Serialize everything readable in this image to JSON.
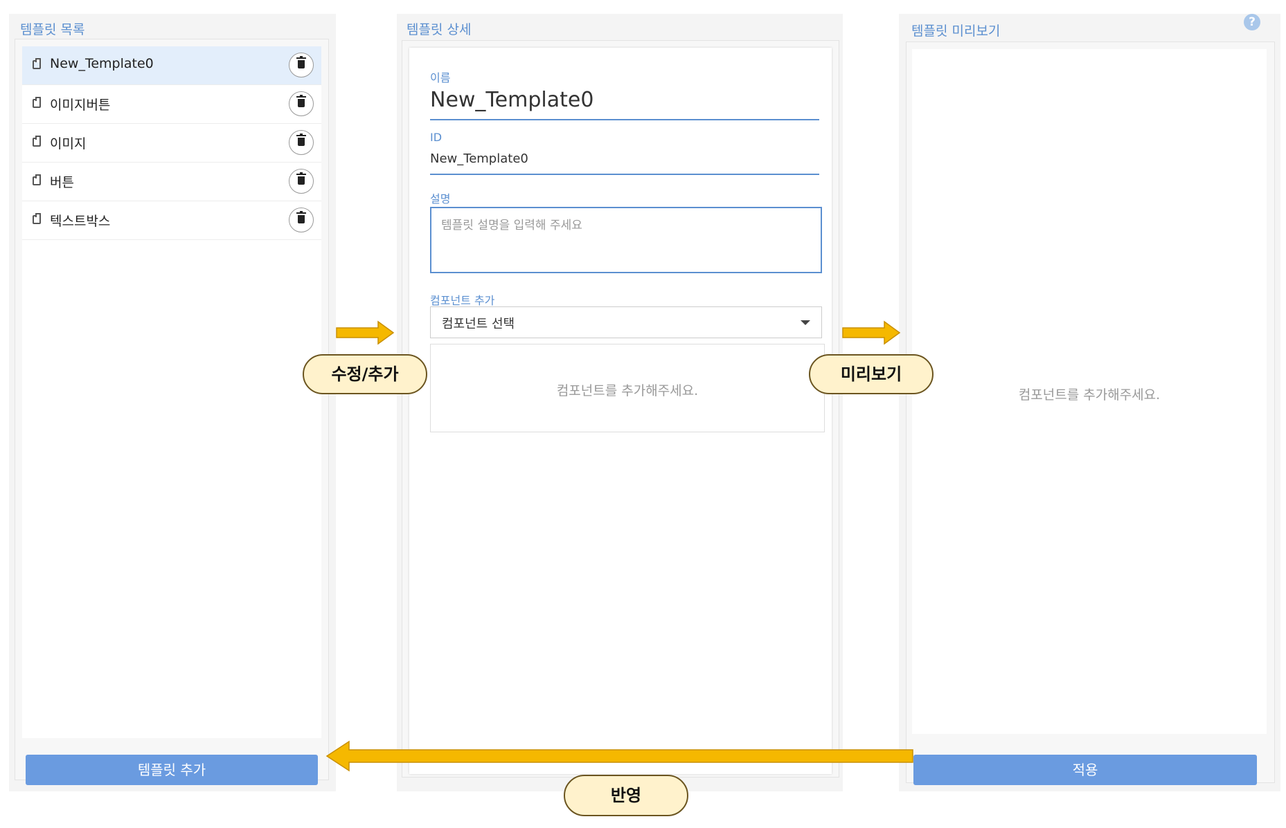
{
  "left_panel": {
    "title": "템플릿 목록",
    "items": [
      {
        "label": "New_Template0",
        "selected": true
      },
      {
        "label": "이미지버튼",
        "selected": false
      },
      {
        "label": "이미지",
        "selected": false
      },
      {
        "label": "버튼",
        "selected": false
      },
      {
        "label": "텍스트박스",
        "selected": false
      }
    ],
    "add_button": "템플릿 추가"
  },
  "middle_panel": {
    "title": "템플릿 상세",
    "name_label": "이름",
    "name_value": "New_Template0",
    "id_label": "ID",
    "id_value": "New_Template0",
    "desc_label": "설명",
    "desc_placeholder": "템플릿 설명을 입력해 주세요",
    "component_label": "컴포넌트 추가",
    "component_select": "컴포넌트 선택",
    "component_empty": "컴포넌트를 추가해주세요."
  },
  "right_panel": {
    "title": "템플릿 미리보기",
    "empty_text": "컴포넌트를 추가해주세요.",
    "apply_button": "적용",
    "help_icon": "?"
  },
  "annotations": {
    "edit_add": "수정/추가",
    "preview": "미리보기",
    "apply_reflect": "반영",
    "arrow_color": "#f5b800",
    "callout_fill": "#fff2cc"
  },
  "colors": {
    "accent": "#5b8fd0",
    "button": "#6a9be0",
    "selected_row": "#e3eefb"
  }
}
